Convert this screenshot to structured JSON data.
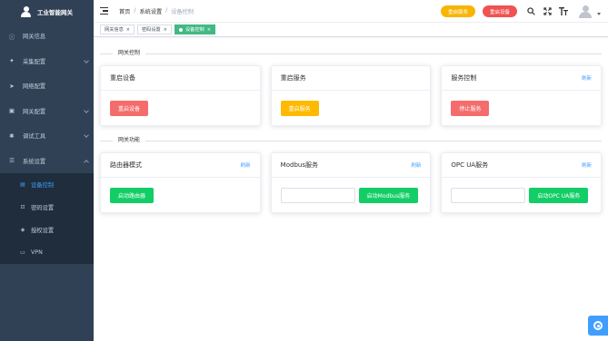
{
  "sidebar": {
    "brand": "工业智能网关",
    "items": [
      {
        "label": "网关信息",
        "icon": "info-icon"
      },
      {
        "label": "采集配置",
        "icon": "gamepad-icon"
      },
      {
        "label": "网络配置",
        "icon": "send-icon"
      },
      {
        "label": "网关配置",
        "icon": "toolbox-icon"
      },
      {
        "label": "调试工具",
        "icon": "bug-icon"
      },
      {
        "label": "系统设置",
        "icon": "list-icon"
      }
    ],
    "sub_items": [
      {
        "label": "设备控制",
        "icon": "device-icon"
      },
      {
        "label": "密码设置",
        "icon": "password-icon"
      },
      {
        "label": "授权设置",
        "icon": "license-icon"
      },
      {
        "label": "VPN",
        "icon": "vpn-icon"
      }
    ]
  },
  "navbar": {
    "breadcrumb": [
      "首页",
      "系统设置",
      "设备控制"
    ],
    "restart_service": "重启服务",
    "restart_device": "重启设备"
  },
  "tags": [
    {
      "label": "网关信息"
    },
    {
      "label": "密码设置"
    },
    {
      "label": "设备控制"
    }
  ],
  "sections": {
    "gateway_control": "网关控制",
    "gateway_functions": "网关功能"
  },
  "cards": {
    "restart_device": {
      "title": "重启设备",
      "button": "重启设备"
    },
    "restart_service": {
      "title": "重启服务",
      "button": "重启服务"
    },
    "service_control": {
      "title": "服务控制",
      "refresh": "刷新",
      "button": "停止服务"
    },
    "router_mode": {
      "title": "路由器模式",
      "refresh": "刷新",
      "button": "启动路由器"
    },
    "modbus": {
      "title": "Modbus服务",
      "refresh": "刷新",
      "button": "启动Modbus服务",
      "input_value": ""
    },
    "opcua": {
      "title": "OPC UA服务",
      "refresh": "刷新",
      "button": "启动OPC UA服务",
      "input_value": ""
    }
  },
  "colors": {
    "sidebar_bg": "#304156",
    "submenu_bg": "#1f2d3d",
    "accent": "#409eff",
    "tag_active": "#42b983",
    "danger": "#f56c6c",
    "warning": "#ffba00",
    "success": "#13ce66"
  }
}
